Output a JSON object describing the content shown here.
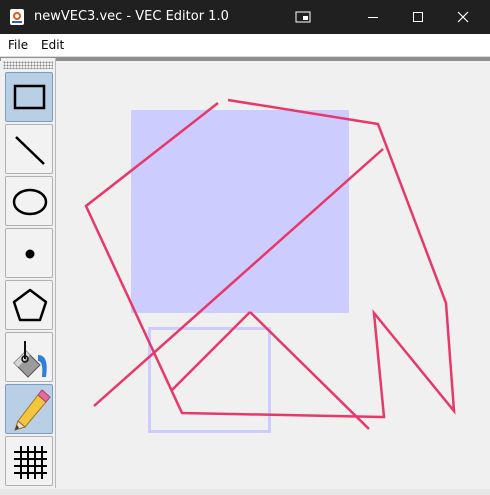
{
  "window": {
    "title": "newVEC3.vec - VEC Editor 1.0",
    "controls": [
      "minimize",
      "maximize",
      "close"
    ]
  },
  "menu": {
    "items": [
      "File",
      "Edit"
    ]
  },
  "toolbar": {
    "tools": [
      {
        "name": "rectangle",
        "icon": "rectangle-icon",
        "selected": true
      },
      {
        "name": "line",
        "icon": "line-icon",
        "selected": false
      },
      {
        "name": "ellipse",
        "icon": "ellipse-icon",
        "selected": false
      },
      {
        "name": "point",
        "icon": "point-icon",
        "selected": false
      },
      {
        "name": "polygon",
        "icon": "pentagon-icon",
        "selected": false
      },
      {
        "name": "fill",
        "icon": "paint-bucket-icon",
        "selected": false
      },
      {
        "name": "pen",
        "icon": "pencil-icon",
        "selected": true
      },
      {
        "name": "grid",
        "icon": "grid-icon",
        "selected": false
      }
    ]
  },
  "drawing": {
    "pen_color": "#e8386a",
    "fill_color": "#ccccff",
    "outline_color": "#ccccff"
  }
}
